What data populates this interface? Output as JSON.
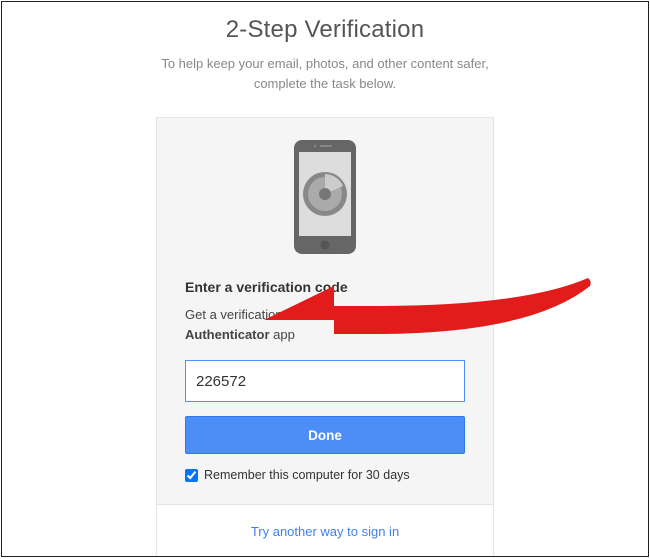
{
  "header": {
    "title": "2-Step Verification",
    "subtitle_line1": "To help keep your email, photos, and other content safer,",
    "subtitle_line2": "complete the task below."
  },
  "card": {
    "prompt_title": "Enter a verification code",
    "prompt_prefix": "Get a verification code from the ",
    "prompt_app_name": "Google Authenticator",
    "prompt_suffix": " app",
    "code_value": "226572",
    "done_label": "Done",
    "remember_label": "Remember this computer for 30 days",
    "remember_checked": true
  },
  "footer": {
    "alt_link": "Try another way to sign in"
  },
  "icons": {
    "phone": "phone-authenticator-icon",
    "annotation_arrow": "red-arrow-annotation"
  }
}
